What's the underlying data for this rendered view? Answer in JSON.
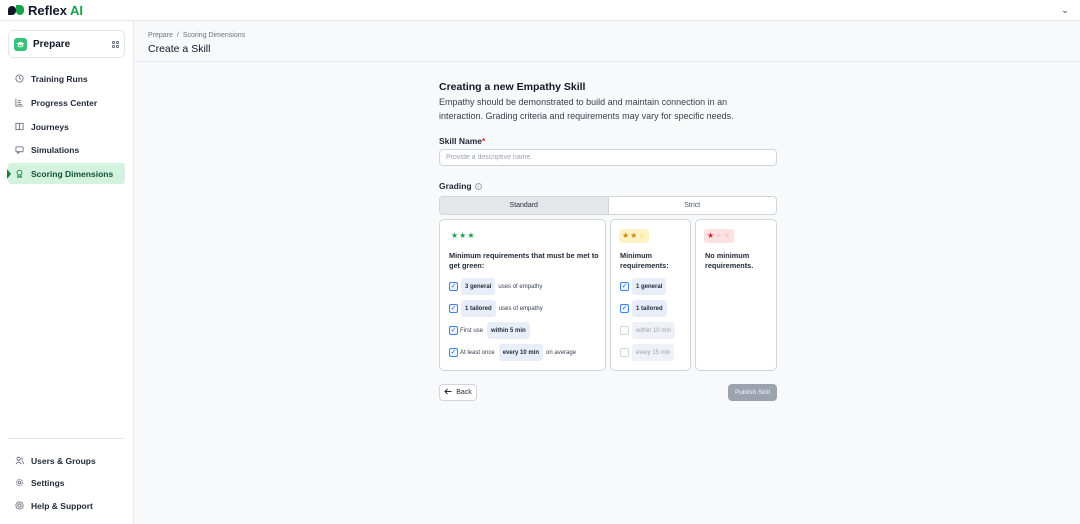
{
  "brand": {
    "name": "Reflex",
    "suffix": "AI"
  },
  "sidebar": {
    "workspace": {
      "label": "Prepare",
      "icon": "graduation-cap-icon"
    },
    "items": [
      {
        "label": "Training Runs",
        "icon": "clock-icon",
        "active": false
      },
      {
        "label": "Progress Center",
        "icon": "chart-icon",
        "active": false
      },
      {
        "label": "Journeys",
        "icon": "book-icon",
        "active": false
      },
      {
        "label": "Simulations",
        "icon": "chat-icon",
        "active": false
      },
      {
        "label": "Scoring Dimensions",
        "icon": "award-icon",
        "active": true
      }
    ],
    "bottom_items": [
      {
        "label": "Users & Groups",
        "icon": "users-icon"
      },
      {
        "label": "Settings",
        "icon": "gear-icon"
      },
      {
        "label": "Help & Support",
        "icon": "lifebuoy-icon"
      }
    ]
  },
  "header": {
    "breadcrumb": [
      "Prepare",
      "/",
      "Scoring Dimensions"
    ],
    "title": "Create a Skill"
  },
  "form": {
    "title": "Creating a new Empathy Skill",
    "description": "Empathy should be demonstrated to build and maintain connection in an interaction. Grading criteria and requirements may vary for specific needs.",
    "skill_name_label": "Skill Name",
    "skill_name_required": "*",
    "skill_name_value": "",
    "skill_name_placeholder": "Provide a descriptive name.",
    "grading_label": "Grading",
    "grading_options": [
      "Standard",
      "Strict"
    ],
    "grading_selected": "Standard",
    "cards": {
      "green": {
        "stars": 3,
        "color": "#16a34a",
        "heading": "Minimum requirements that must be met to get green:",
        "rows": [
          {
            "checked": true,
            "before": "",
            "chip": "3 general",
            "after": "uses of empathy"
          },
          {
            "checked": true,
            "before": "",
            "chip": "1 tailored",
            "after": "uses of empathy"
          },
          {
            "checked": true,
            "before": "First use",
            "chip": "within 5 min",
            "after": ""
          },
          {
            "checked": true,
            "before": "At least once",
            "chip": "every 10 min",
            "after": "on average"
          }
        ]
      },
      "yellow": {
        "stars": 2,
        "color": "#ca8a04",
        "heading": "Minimum requirements:",
        "rows": [
          {
            "checked": true,
            "chip": "1 general"
          },
          {
            "checked": true,
            "chip": "1 tailored"
          },
          {
            "checked": false,
            "chip": "within 10 min"
          },
          {
            "checked": false,
            "chip": "every 15 min"
          }
        ]
      },
      "red": {
        "stars": 1,
        "color": "#dc2626",
        "heading": "No minimum requirements."
      }
    },
    "back_label": "Back",
    "publish_label": "Publish Skill"
  }
}
